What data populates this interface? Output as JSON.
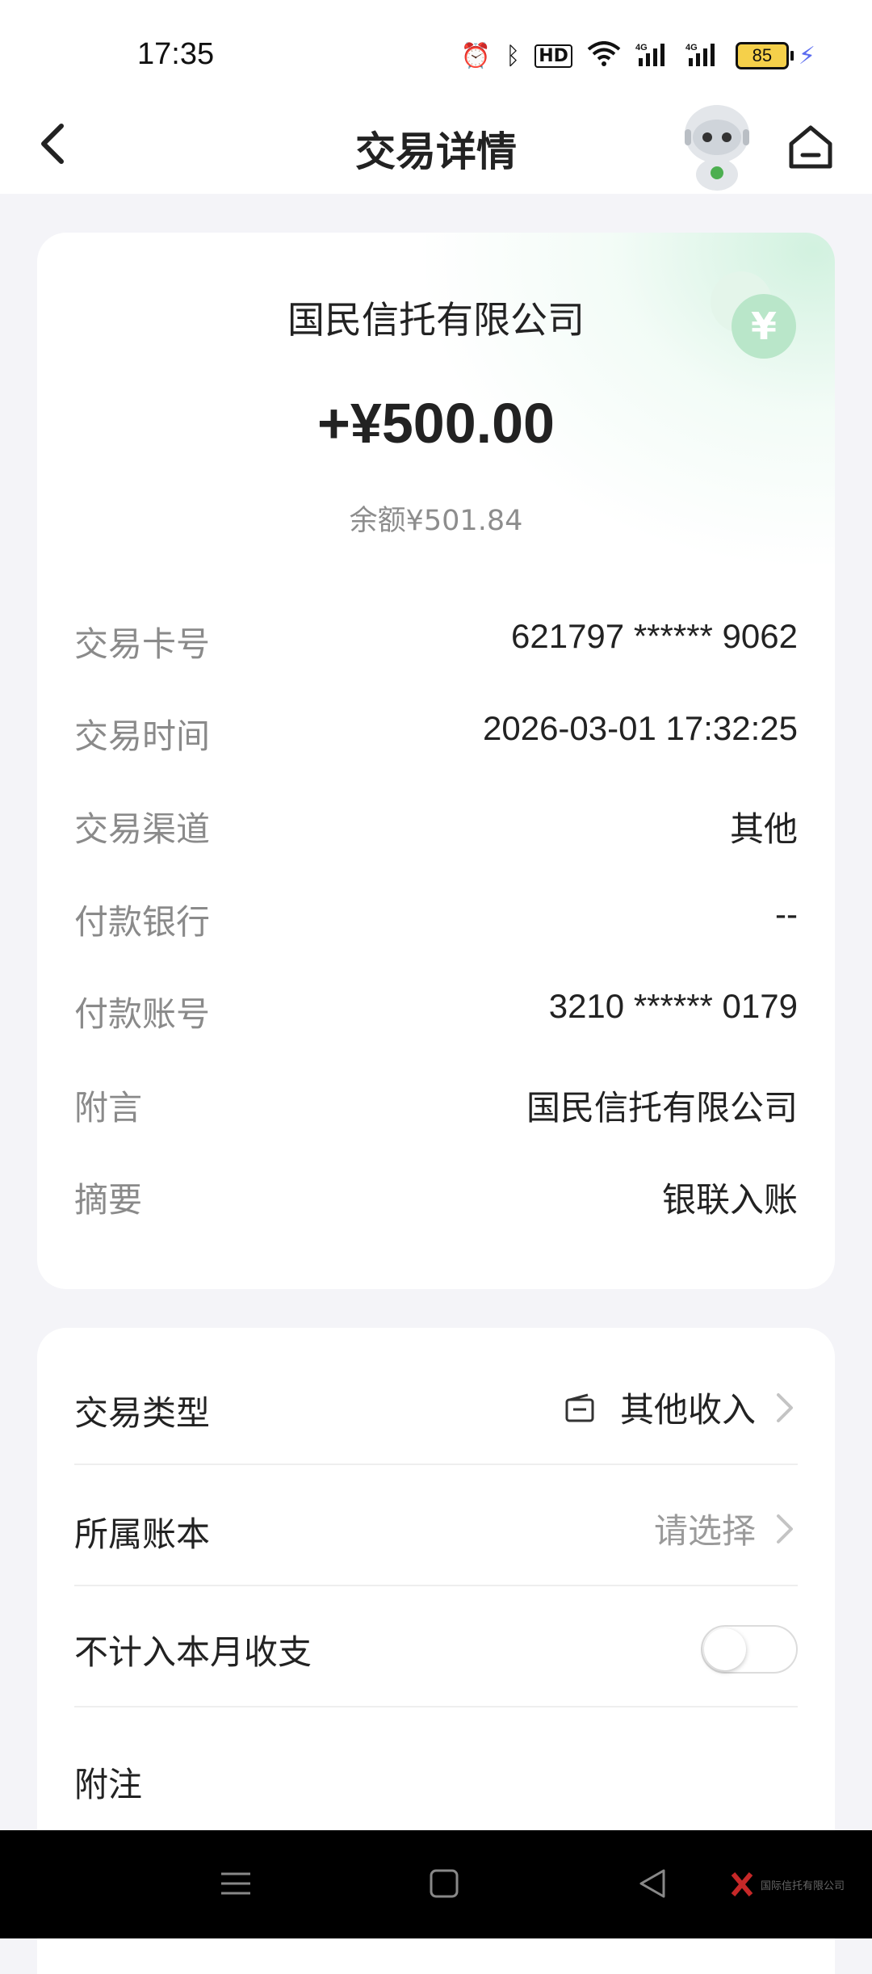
{
  "status_bar": {
    "time": "17:35",
    "battery": "85",
    "icons": [
      "alarm-icon",
      "bluetooth-icon",
      "hd-icon",
      "wifi-icon",
      "signal-4g-icon",
      "signal-4g-icon",
      "charging-icon"
    ]
  },
  "nav": {
    "title": "交易详情",
    "back_icon": "chevron-left-icon",
    "home_icon": "home-icon"
  },
  "transaction": {
    "merchant": "国民信托有限公司",
    "amount": "+¥500.00",
    "balance": "余额¥501.84",
    "details": [
      {
        "label": "交易卡号",
        "value": "621797 ****** 9062"
      },
      {
        "label": "交易时间",
        "value": "2026-03-01 17:32:25"
      },
      {
        "label": "交易渠道",
        "value": "其他"
      },
      {
        "label": "付款银行",
        "value": "--"
      },
      {
        "label": "付款账号",
        "value": "3210 ****** 0179"
      },
      {
        "label": "附言",
        "value": "国民信托有限公司"
      },
      {
        "label": "摘要",
        "value": "银联入账"
      }
    ]
  },
  "options": {
    "type": {
      "label": "交易类型",
      "value": "其他收入"
    },
    "book": {
      "label": "所属账本",
      "placeholder": "请选择"
    },
    "exclude": {
      "label": "不计入本月收支",
      "enabled": false
    },
    "note": {
      "label": "附注"
    }
  },
  "watermark": "国际信托有限公司",
  "colors": {
    "accent_green": "#b9e6c9",
    "background": "#f4f4f8",
    "label_gray": "#8a8a8a"
  }
}
